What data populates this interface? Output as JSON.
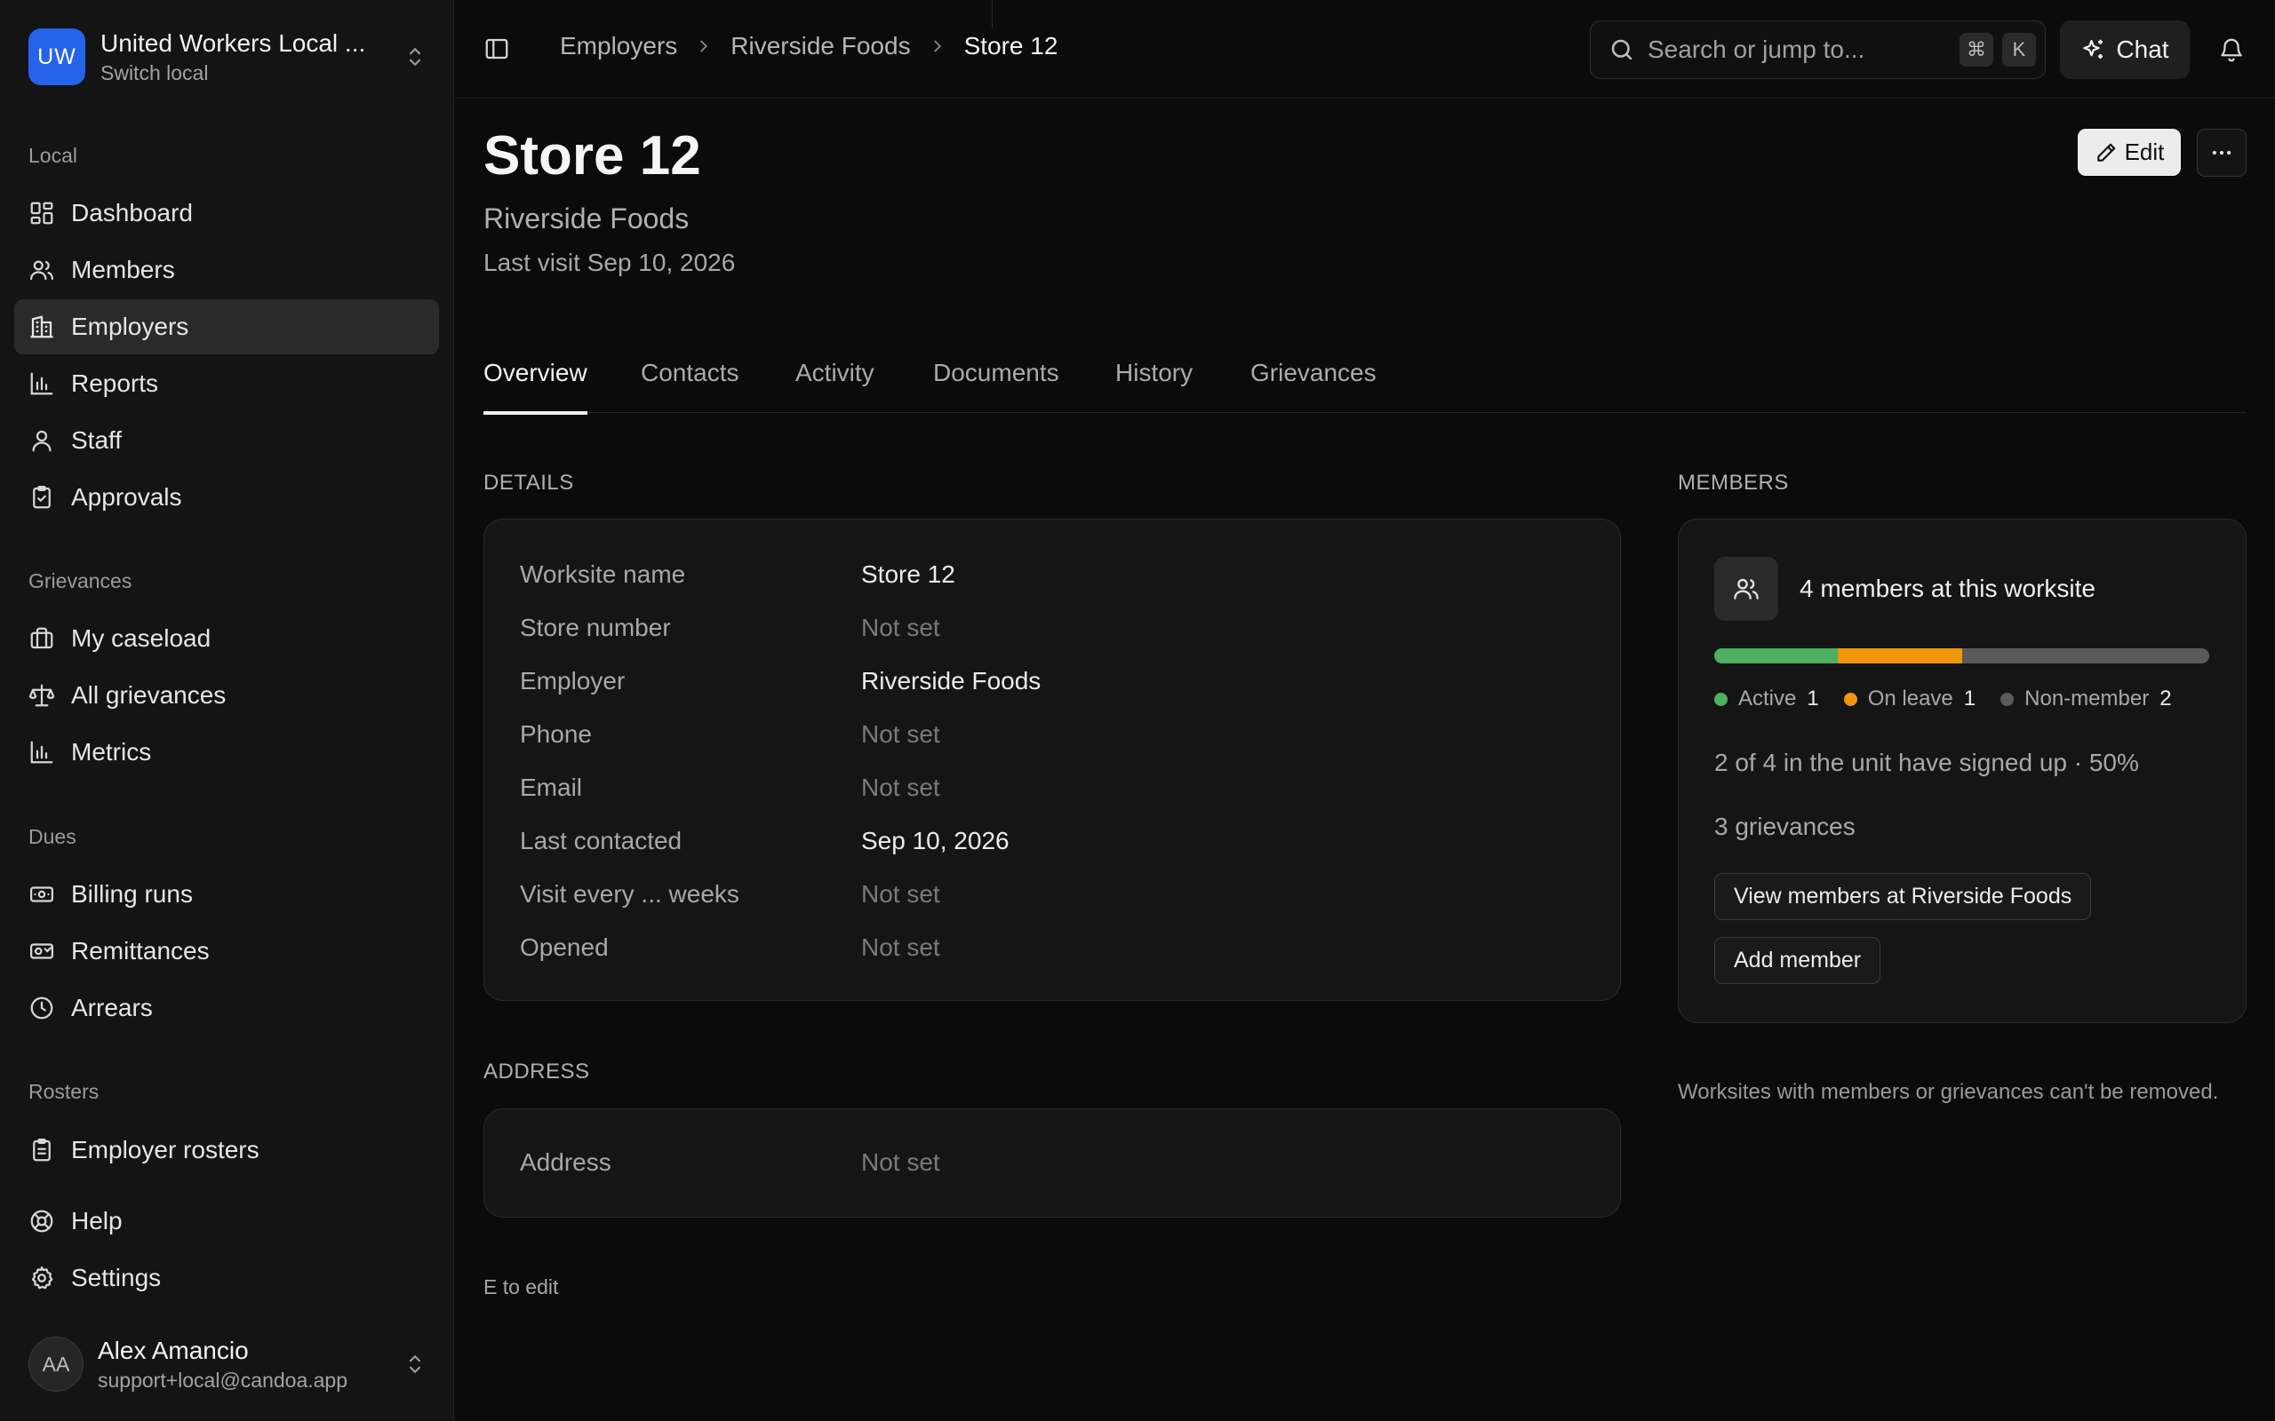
{
  "org": {
    "initials": "UW",
    "name": "United Workers Local ...",
    "subtitle": "Switch local"
  },
  "sidebar": {
    "sections": {
      "local": "Local",
      "grievances": "Grievances",
      "dues": "Dues",
      "rosters": "Rosters"
    },
    "items": {
      "dashboard": "Dashboard",
      "members": "Members",
      "employers": "Employers",
      "reports": "Reports",
      "staff": "Staff",
      "approvals": "Approvals",
      "my_caseload": "My caseload",
      "all_grievances": "All grievances",
      "metrics": "Metrics",
      "billing_runs": "Billing runs",
      "remittances": "Remittances",
      "arrears": "Arrears",
      "employer_rosters": "Employer rosters",
      "help": "Help",
      "settings": "Settings"
    },
    "active_item": "employers",
    "user": {
      "initials": "AA",
      "name": "Alex Amancio",
      "email": "support+local@candoa.app"
    }
  },
  "topbar": {
    "breadcrumbs": [
      "Employers",
      "Riverside Foods",
      "Store 12"
    ],
    "search_placeholder": "Search or jump to...",
    "shortcut_keys": [
      "⌘",
      "K"
    ],
    "chat_label": "Chat"
  },
  "page": {
    "title": "Store 12",
    "subtitle": "Riverside Foods",
    "meta": "Last visit Sep 10, 2026",
    "edit_label": "Edit",
    "tabs": [
      "Overview",
      "Contacts",
      "Activity",
      "Documents",
      "History",
      "Grievances"
    ],
    "active_tab": "Overview",
    "hint": "E to edit"
  },
  "details": {
    "label": "DETAILS",
    "rows": [
      {
        "key": "Worksite name",
        "value": "Store 12",
        "set": true
      },
      {
        "key": "Store number",
        "value": "Not set",
        "set": false
      },
      {
        "key": "Employer",
        "value": "Riverside Foods",
        "set": true
      },
      {
        "key": "Phone",
        "value": "Not set",
        "set": false
      },
      {
        "key": "Email",
        "value": "Not set",
        "set": false
      },
      {
        "key": "Last contacted",
        "value": "Sep 10, 2026",
        "set": true
      },
      {
        "key": "Visit every ... weeks",
        "value": "Not set",
        "set": false
      },
      {
        "key": "Opened",
        "value": "Not set",
        "set": false
      }
    ]
  },
  "address": {
    "label": "ADDRESS",
    "rows": [
      {
        "key": "Address",
        "value": "Not set",
        "set": false
      }
    ]
  },
  "members": {
    "label": "MEMBERS",
    "title": "4 members at this worksite",
    "breakdown": [
      {
        "label": "Active",
        "count": 1,
        "color": "#4caf62"
      },
      {
        "label": "On leave",
        "count": 1,
        "color": "#f0950c"
      },
      {
        "label": "Non-member",
        "count": 2,
        "color": "#5a5a5a"
      }
    ],
    "signup_text": "2 of 4 in the unit have signed up · 50%",
    "grievances_text": "3 grievances",
    "view_button": "View members at Riverside Foods",
    "add_button": "Add member",
    "footnote": "Worksites with members or grievances can't be removed."
  }
}
